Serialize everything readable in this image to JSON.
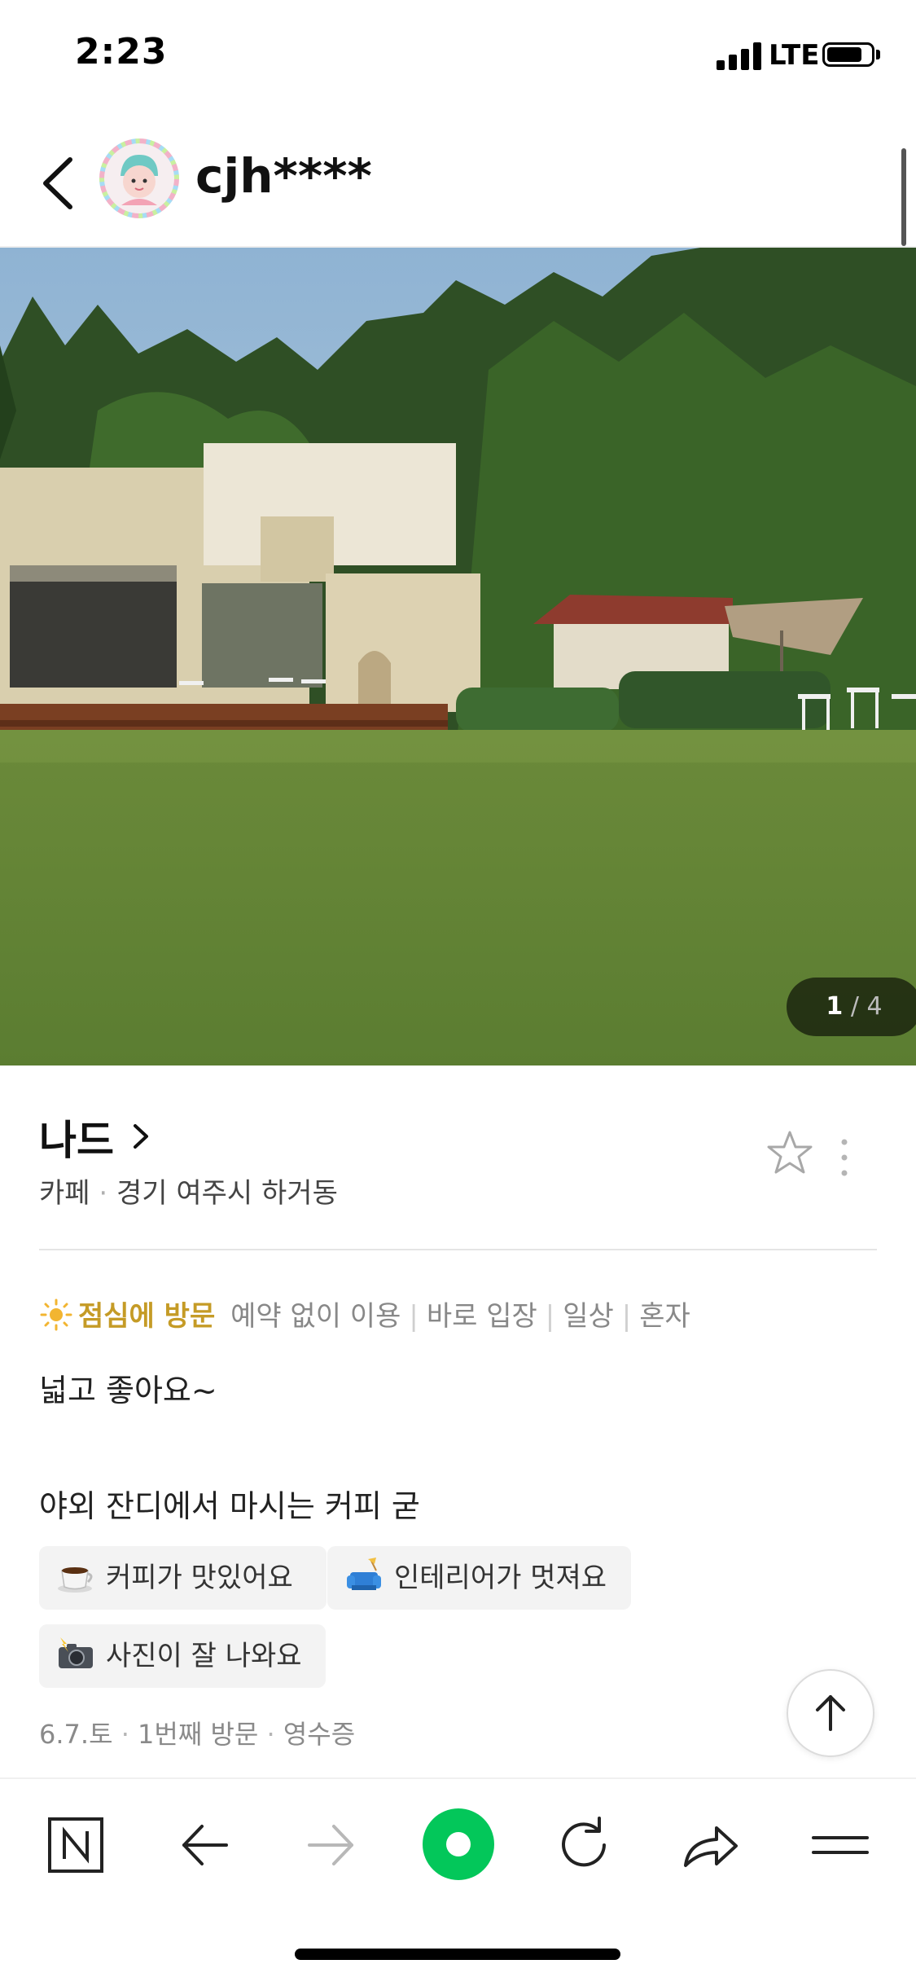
{
  "status_bar": {
    "time": "2:23",
    "network": "LTE"
  },
  "header": {
    "username": "cjh****"
  },
  "photo": {
    "index": "1",
    "separator": "/",
    "total": "4"
  },
  "place": {
    "name": "나드",
    "category": "카페",
    "separator": "·",
    "location": "경기 여주시 하거동"
  },
  "review": {
    "visit_time": "점심에 방문",
    "keywords": [
      "예약 없이 이용",
      "바로 입장",
      "일상",
      "혼자"
    ],
    "keyword_separator": "|",
    "line1": "넓고 좋아요~",
    "line2": "야외 잔디에서 마시는 커피 굳",
    "tags": [
      {
        "icon": "coffee-icon",
        "label": "커피가 맛있어요"
      },
      {
        "icon": "sofa-icon",
        "label": "인테리어가 멋져요"
      },
      {
        "icon": "camera-flash-icon",
        "label": "사진이 잘 나와요"
      }
    ],
    "visit_info": {
      "date": "6.7.토",
      "count": "1번째 방문",
      "proof": "영수증",
      "separator": "·"
    }
  },
  "colors": {
    "accent_visit": "#c59b26",
    "naver_green": "#03c75a"
  },
  "toolbar": {
    "icons": [
      "naver-n-icon",
      "arrow-left-icon",
      "arrow-right-icon",
      "green-dot-icon",
      "refresh-icon",
      "share-icon",
      "menu-icon"
    ]
  }
}
